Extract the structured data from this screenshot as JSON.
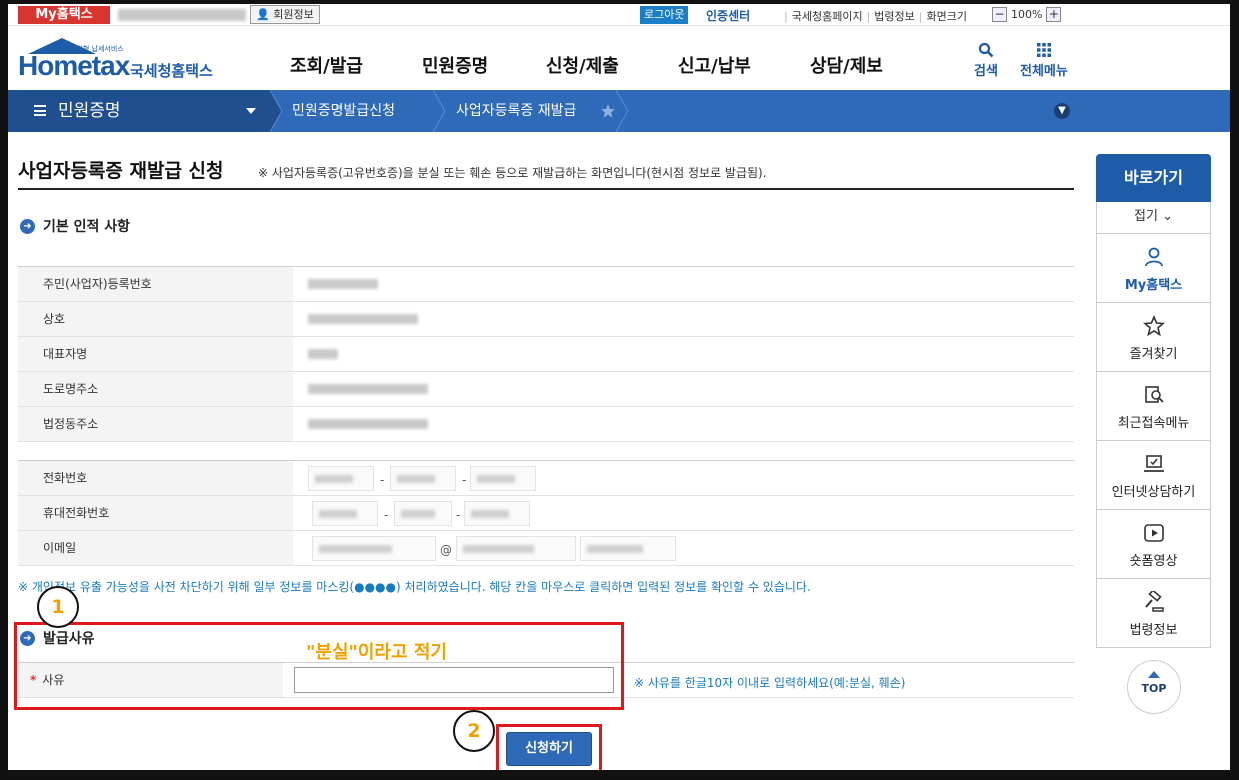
{
  "topbar": {
    "my_hometax": "My홈택스",
    "member_info": "회원정보",
    "logout": "로그아웃",
    "cert_center": "인증센터",
    "links": [
      "국세청홈페이지",
      "법령정보",
      "화면크기"
    ],
    "zoom_minus": "−",
    "zoom_level": "100%",
    "zoom_plus": "+"
  },
  "header": {
    "logo_small": "민원형 납세서비스",
    "logo_main": "Hometax",
    "logo_kor": "국세청홈택스",
    "gnb": [
      "조회/발급",
      "민원증명",
      "신청/제출",
      "신고/납부",
      "상담/제보"
    ],
    "search_label": "검색",
    "all_menu_label": "전체메뉴"
  },
  "nav": {
    "menu_label": "민원증명",
    "crumbs": [
      "민원증명발급신청",
      "사업자등록증 재발급"
    ]
  },
  "page": {
    "title": "사업자등록증 재발급 신청",
    "description": "※ 사업자등록증(고유번호증)을 분실 또는 훼손 등으로 재발급하는 화면입니다(현시점 정보로 발급됨)."
  },
  "basic_info": {
    "section_title": "기본 인적 사항",
    "rows": [
      "주민(사업자)등록번호",
      "상호",
      "대표자명",
      "도로명주소",
      "법정동주소"
    ],
    "contact_rows": [
      "전화번호",
      "휴대전화번호",
      "이메일"
    ]
  },
  "mask_notice": "※ 개인정보 유출 가능성을 사전 차단하기 위해 일부 정보를 마스킹(●●●●) 처리하였습니다. 해당 칸을 마우스로 클릭하면 입력된 정보를 확인할 수 있습니다.",
  "reason": {
    "section_title": "발급사유",
    "required_mark": "*",
    "label": "사유",
    "value": "",
    "hint": "※ 사유를 한글10자 이내로 입력하세요(예:분실, 훼손)"
  },
  "apply_button": "신청하기",
  "annotations": {
    "step1": "1",
    "step2": "2",
    "instruction": "\"분실\"이라고 적기",
    "color": "#e0191d"
  },
  "quick_panel": {
    "title": "바로가기",
    "fold": "접기",
    "items": [
      {
        "label": "My홈택스",
        "icon": "user-icon"
      },
      {
        "label": "즐겨찾기",
        "icon": "star-icon"
      },
      {
        "label": "최근접속메뉴",
        "icon": "recent-search-icon"
      },
      {
        "label": "인터넷상담하기",
        "icon": "laptop-chat-icon"
      },
      {
        "label": "숏폼영상",
        "icon": "play-icon"
      },
      {
        "label": "법령정보",
        "icon": "gavel-icon"
      }
    ],
    "top": "TOP"
  },
  "colors": {
    "brand_blue": "#1e5ca8",
    "nav_blue": "#2f6ab8",
    "accent_red": "#d9352f",
    "annotation_orange": "#f2a000"
  }
}
